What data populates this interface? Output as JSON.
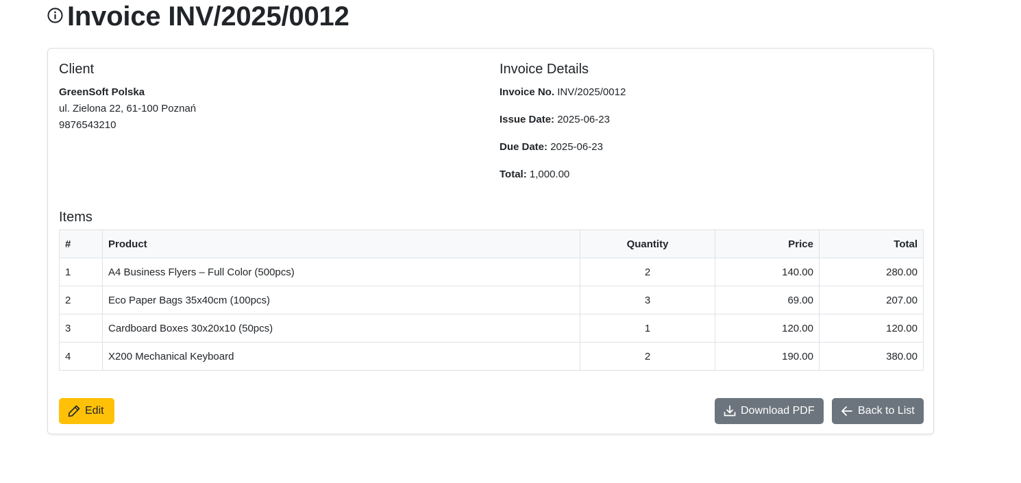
{
  "page": {
    "title": "Invoice INV/2025/0012",
    "title_icon": "info-circle-icon"
  },
  "client": {
    "heading": "Client",
    "name": "GreenSoft Polska",
    "address": "ul. Zielona 22, 61-100 Poznań",
    "tax_id": "9876543210"
  },
  "details": {
    "heading": "Invoice Details",
    "invoice_no_label": "Invoice No.",
    "invoice_no": "INV/2025/0012",
    "issue_date_label": "Issue Date:",
    "issue_date": "2025-06-23",
    "due_date_label": "Due Date:",
    "due_date": "2025-06-23",
    "total_label": "Total:",
    "total": "1,000.00"
  },
  "items": {
    "heading": "Items",
    "columns": [
      "#",
      "Product",
      "Quantity",
      "Price",
      "Total"
    ],
    "rows": [
      {
        "num": "1",
        "product": "A4 Business Flyers – Full Color (500pcs)",
        "quantity": "2",
        "price": "140.00",
        "total": "280.00"
      },
      {
        "num": "2",
        "product": "Eco Paper Bags 35x40cm (100pcs)",
        "quantity": "3",
        "price": "69.00",
        "total": "207.00"
      },
      {
        "num": "3",
        "product": "Cardboard Boxes 30x20x10 (50pcs)",
        "quantity": "1",
        "price": "120.00",
        "total": "120.00"
      },
      {
        "num": "4",
        "product": "X200 Mechanical Keyboard",
        "quantity": "2",
        "price": "190.00",
        "total": "380.00"
      }
    ]
  },
  "actions": {
    "edit_label": "Edit",
    "download_label": "Download PDF",
    "back_label": "Back to List"
  },
  "colors": {
    "edit_button": "#ffc107",
    "secondary_button": "#6c757d",
    "table_header_bg": "#f8f9fa"
  }
}
